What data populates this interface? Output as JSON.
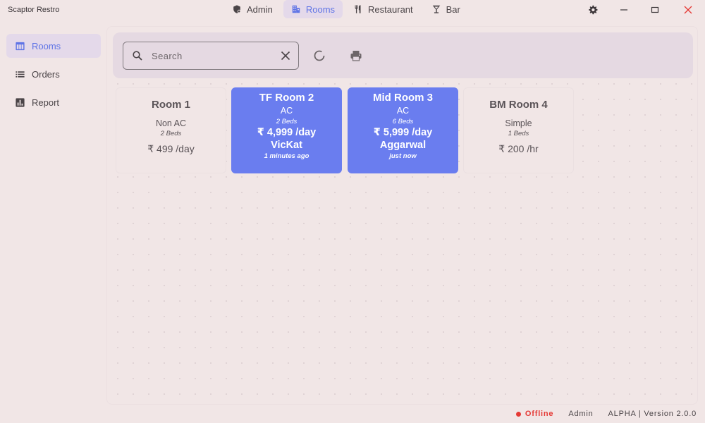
{
  "app": {
    "title": "Scaptor Restro"
  },
  "topnav": [
    {
      "label": "Admin",
      "icon": "shield-icon",
      "active": false
    },
    {
      "label": "Rooms",
      "icon": "building-icon",
      "active": true
    },
    {
      "label": "Restaurant",
      "icon": "fork-knife-icon",
      "active": false
    },
    {
      "label": "Bar",
      "icon": "cocktail-icon",
      "active": false
    }
  ],
  "sidebar": {
    "items": [
      {
        "label": "Rooms",
        "icon": "table-icon",
        "active": true
      },
      {
        "label": "Orders",
        "icon": "list-icon",
        "active": false
      },
      {
        "label": "Report",
        "icon": "bar-chart-icon",
        "active": false
      }
    ]
  },
  "search": {
    "placeholder": "Search",
    "value": ""
  },
  "rooms": [
    {
      "name": "Room 1",
      "type": "Non AC",
      "beds": "2 Beds",
      "price": "₹ 499 /day",
      "occupied": false
    },
    {
      "name": "TF Room 2",
      "type": "AC",
      "beds": "2 Beds",
      "price": "₹ 4,999 /day",
      "guest": "VicKat",
      "time": "1 minutes ago",
      "occupied": true
    },
    {
      "name": "Mid Room 3",
      "type": "AC",
      "beds": "6 Beds",
      "price": "₹ 5,999 /day",
      "guest": "Aggarwal",
      "time": "just now",
      "occupied": true
    },
    {
      "name": "BM Room 4",
      "type": "Simple",
      "beds": "1 Beds",
      "price": "₹ 200 /hr",
      "occupied": false
    }
  ],
  "status": {
    "connection": "Offline",
    "user": "Admin",
    "version": "ALPHA | Version 2.0.0"
  },
  "colors": {
    "accent": "#5f74e6",
    "card_busy": "#6a7def",
    "offline": "#e53935",
    "background": "#f1e6e6"
  }
}
